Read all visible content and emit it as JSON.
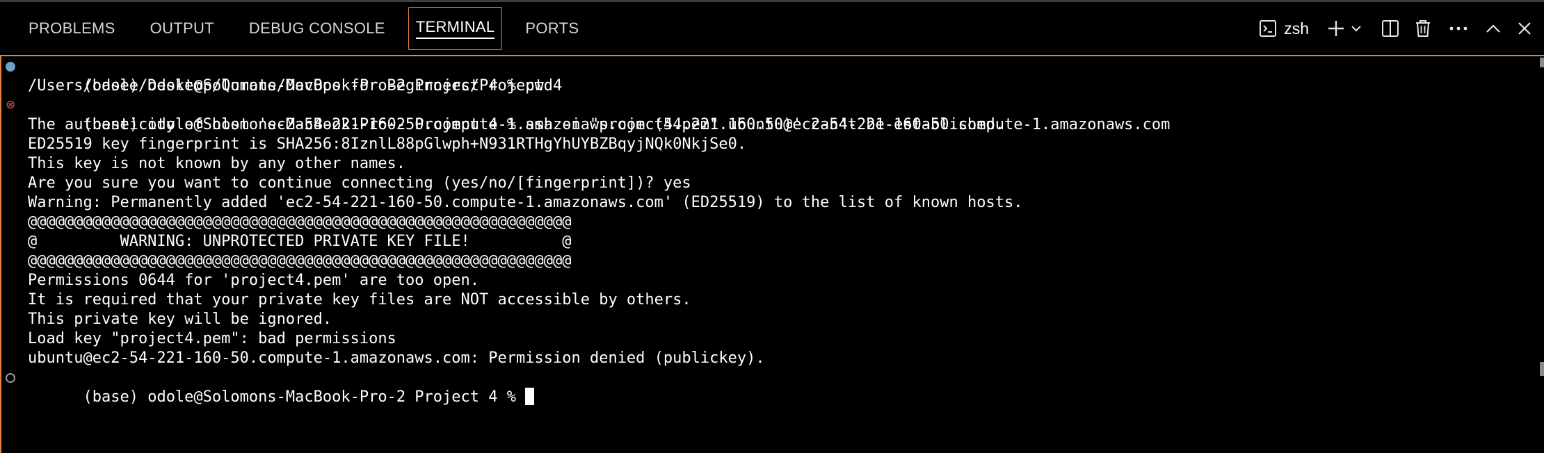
{
  "panel": {
    "tabs": [
      {
        "label": "PROBLEMS"
      },
      {
        "label": "OUTPUT"
      },
      {
        "label": "DEBUG CONSOLE"
      },
      {
        "label": "TERMINAL",
        "active": true
      },
      {
        "label": "PORTS"
      }
    ],
    "shell_name": "zsh",
    "icons": [
      "terminal-icon",
      "plus-icon",
      "chevron-down-icon",
      "split-icon",
      "trash-icon",
      "more-icon",
      "chevron-up-icon",
      "close-icon"
    ]
  },
  "terminal": {
    "lines": [
      "(base) odole@Solomons-MacBook-Pro-2 Project 4 % pwd",
      "/Users/odole/Desktop/Qurate/DevOps for Beginners/Project 4",
      "(base) odole@Solomons-MacBook-Pro-2 Project 4 % ssh -i \"project4.pem\" ubuntu@ec2-54-221-160-50.compute-1.amazonaws.com",
      "The authenticity of host 'ec2-54-221-160-50.compute-1.amazonaws.com (54.221.160.50)' can't be established.",
      "ED25519 key fingerprint is SHA256:8IznlL88pGlwph+N931RTHgYhUYBZBqyjNQk0NkjSe0.",
      "This key is not known by any other names.",
      "Are you sure you want to continue connecting (yes/no/[fingerprint])? yes",
      "Warning: Permanently added 'ec2-54-221-160-50.compute-1.amazonaws.com' (ED25519) to the list of known hosts.",
      "@@@@@@@@@@@@@@@@@@@@@@@@@@@@@@@@@@@@@@@@@@@@@@@@@@@@@@@@@@@",
      "@         WARNING: UNPROTECTED PRIVATE KEY FILE!          @",
      "@@@@@@@@@@@@@@@@@@@@@@@@@@@@@@@@@@@@@@@@@@@@@@@@@@@@@@@@@@@",
      "Permissions 0644 for 'project4.pem' are too open.",
      "It is required that your private key files are NOT accessible by others.",
      "This private key will be ignored.",
      "Load key \"project4.pem\": bad permissions",
      "ubuntu@ec2-54-221-160-50.compute-1.amazonaws.com: Permission denied (publickey).",
      "(base) odole@Solomons-MacBook-Pro-2 Project 4 % "
    ]
  },
  "colors": {
    "accent": "#e8843a",
    "info_decoration": "#6da2c7",
    "error_decoration": "#e05252",
    "background": "#000000"
  }
}
